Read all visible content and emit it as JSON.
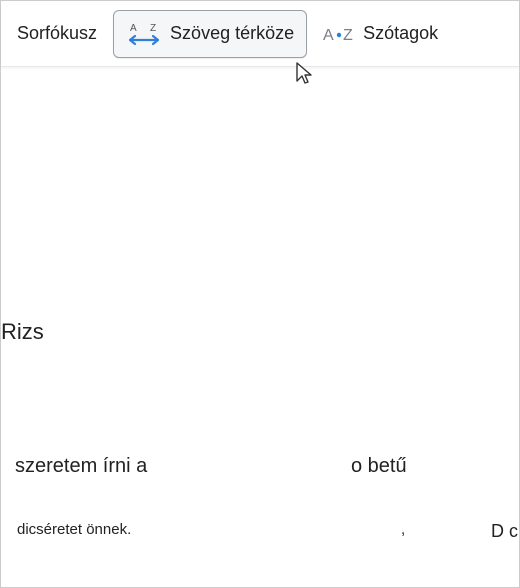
{
  "toolbar": {
    "items": [
      {
        "label": "Sorfókusz"
      },
      {
        "label": "Szöveg térköze"
      },
      {
        "label": "Szótagok"
      }
    ]
  },
  "content": {
    "rizs": "Rizs",
    "szeretem": "szeretem írni a",
    "obetu": "o betű",
    "dicseret": "dicséretet önnek.",
    "comma": ",",
    "dc": "D c"
  },
  "colors": {
    "iconBlue": "#2f7ed8",
    "iconGray": "#7a7f85"
  }
}
